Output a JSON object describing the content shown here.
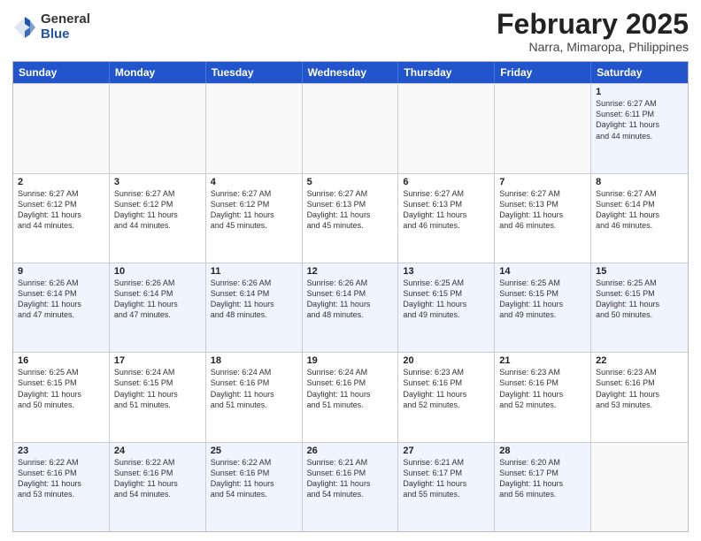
{
  "logo": {
    "general": "General",
    "blue": "Blue"
  },
  "title": "February 2025",
  "subtitle": "Narra, Mimaropa, Philippines",
  "days": [
    "Sunday",
    "Monday",
    "Tuesday",
    "Wednesday",
    "Thursday",
    "Friday",
    "Saturday"
  ],
  "rows": [
    [
      {
        "day": "",
        "text": ""
      },
      {
        "day": "",
        "text": ""
      },
      {
        "day": "",
        "text": ""
      },
      {
        "day": "",
        "text": ""
      },
      {
        "day": "",
        "text": ""
      },
      {
        "day": "",
        "text": ""
      },
      {
        "day": "1",
        "text": "Sunrise: 6:27 AM\nSunset: 6:11 PM\nDaylight: 11 hours\nand 44 minutes."
      }
    ],
    [
      {
        "day": "2",
        "text": "Sunrise: 6:27 AM\nSunset: 6:12 PM\nDaylight: 11 hours\nand 44 minutes."
      },
      {
        "day": "3",
        "text": "Sunrise: 6:27 AM\nSunset: 6:12 PM\nDaylight: 11 hours\nand 44 minutes."
      },
      {
        "day": "4",
        "text": "Sunrise: 6:27 AM\nSunset: 6:12 PM\nDaylight: 11 hours\nand 45 minutes."
      },
      {
        "day": "5",
        "text": "Sunrise: 6:27 AM\nSunset: 6:13 PM\nDaylight: 11 hours\nand 45 minutes."
      },
      {
        "day": "6",
        "text": "Sunrise: 6:27 AM\nSunset: 6:13 PM\nDaylight: 11 hours\nand 46 minutes."
      },
      {
        "day": "7",
        "text": "Sunrise: 6:27 AM\nSunset: 6:13 PM\nDaylight: 11 hours\nand 46 minutes."
      },
      {
        "day": "8",
        "text": "Sunrise: 6:27 AM\nSunset: 6:14 PM\nDaylight: 11 hours\nand 46 minutes."
      }
    ],
    [
      {
        "day": "9",
        "text": "Sunrise: 6:26 AM\nSunset: 6:14 PM\nDaylight: 11 hours\nand 47 minutes."
      },
      {
        "day": "10",
        "text": "Sunrise: 6:26 AM\nSunset: 6:14 PM\nDaylight: 11 hours\nand 47 minutes."
      },
      {
        "day": "11",
        "text": "Sunrise: 6:26 AM\nSunset: 6:14 PM\nDaylight: 11 hours\nand 48 minutes."
      },
      {
        "day": "12",
        "text": "Sunrise: 6:26 AM\nSunset: 6:14 PM\nDaylight: 11 hours\nand 48 minutes."
      },
      {
        "day": "13",
        "text": "Sunrise: 6:25 AM\nSunset: 6:15 PM\nDaylight: 11 hours\nand 49 minutes."
      },
      {
        "day": "14",
        "text": "Sunrise: 6:25 AM\nSunset: 6:15 PM\nDaylight: 11 hours\nand 49 minutes."
      },
      {
        "day": "15",
        "text": "Sunrise: 6:25 AM\nSunset: 6:15 PM\nDaylight: 11 hours\nand 50 minutes."
      }
    ],
    [
      {
        "day": "16",
        "text": "Sunrise: 6:25 AM\nSunset: 6:15 PM\nDaylight: 11 hours\nand 50 minutes."
      },
      {
        "day": "17",
        "text": "Sunrise: 6:24 AM\nSunset: 6:15 PM\nDaylight: 11 hours\nand 51 minutes."
      },
      {
        "day": "18",
        "text": "Sunrise: 6:24 AM\nSunset: 6:16 PM\nDaylight: 11 hours\nand 51 minutes."
      },
      {
        "day": "19",
        "text": "Sunrise: 6:24 AM\nSunset: 6:16 PM\nDaylight: 11 hours\nand 51 minutes."
      },
      {
        "day": "20",
        "text": "Sunrise: 6:23 AM\nSunset: 6:16 PM\nDaylight: 11 hours\nand 52 minutes."
      },
      {
        "day": "21",
        "text": "Sunrise: 6:23 AM\nSunset: 6:16 PM\nDaylight: 11 hours\nand 52 minutes."
      },
      {
        "day": "22",
        "text": "Sunrise: 6:23 AM\nSunset: 6:16 PM\nDaylight: 11 hours\nand 53 minutes."
      }
    ],
    [
      {
        "day": "23",
        "text": "Sunrise: 6:22 AM\nSunset: 6:16 PM\nDaylight: 11 hours\nand 53 minutes."
      },
      {
        "day": "24",
        "text": "Sunrise: 6:22 AM\nSunset: 6:16 PM\nDaylight: 11 hours\nand 54 minutes."
      },
      {
        "day": "25",
        "text": "Sunrise: 6:22 AM\nSunset: 6:16 PM\nDaylight: 11 hours\nand 54 minutes."
      },
      {
        "day": "26",
        "text": "Sunrise: 6:21 AM\nSunset: 6:16 PM\nDaylight: 11 hours\nand 54 minutes."
      },
      {
        "day": "27",
        "text": "Sunrise: 6:21 AM\nSunset: 6:17 PM\nDaylight: 11 hours\nand 55 minutes."
      },
      {
        "day": "28",
        "text": "Sunrise: 6:20 AM\nSunset: 6:17 PM\nDaylight: 11 hours\nand 56 minutes."
      },
      {
        "day": "",
        "text": ""
      }
    ]
  ]
}
